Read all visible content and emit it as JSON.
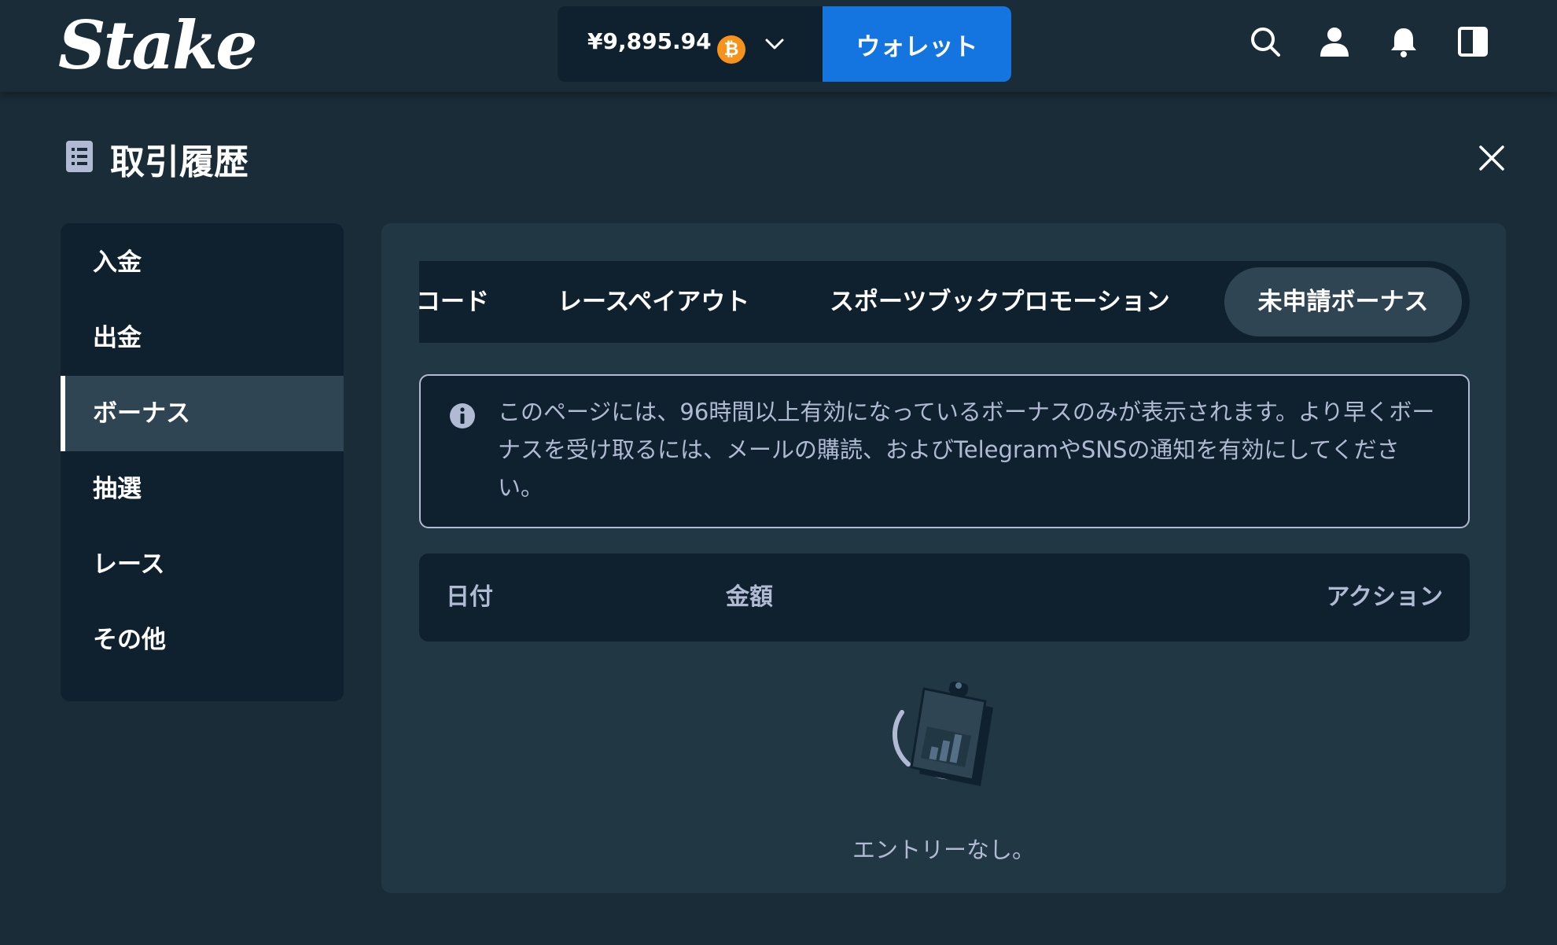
{
  "header": {
    "logo": "Stake",
    "balance": "¥9,895.94",
    "currency_icon": "bitcoin-icon",
    "wallet_label": "ウォレット",
    "icons": [
      "search-icon",
      "user-icon",
      "bell-icon",
      "sidebar-toggle-icon"
    ]
  },
  "page": {
    "title": "取引履歴",
    "title_icon": "list-icon",
    "close_icon": "close-icon"
  },
  "sidebar": {
    "items": [
      {
        "label": "入金",
        "active": false
      },
      {
        "label": "出金",
        "active": false
      },
      {
        "label": "ボーナス",
        "active": true
      },
      {
        "label": "抽選",
        "active": false
      },
      {
        "label": "レース",
        "active": false
      },
      {
        "label": "その他",
        "active": false
      }
    ]
  },
  "tabs": [
    {
      "label": "コード",
      "active": false
    },
    {
      "label": "レースペイアウト",
      "active": false
    },
    {
      "label": "スポーツブックプロモーション",
      "active": false
    },
    {
      "label": "未申請ボーナス",
      "active": true
    }
  ],
  "notice": {
    "icon": "info-icon",
    "text": "このページには、96時間以上有効になっているボーナスのみが表示されます。より早くボーナスを受け取るには、メールの購読、およびTelegramやSNSの通知を有効にしてください。"
  },
  "table": {
    "columns": [
      "日付",
      "金額",
      "アクション"
    ],
    "rows": []
  },
  "empty_state": {
    "illustration": "clipboard-chart-icon",
    "text": "エントリーなし。"
  },
  "colors": {
    "background": "#1a2c38",
    "panel": "#213743",
    "dark": "#0f212e",
    "active": "#2f4553",
    "accent": "#1475e1",
    "muted_text": "#b1bad3",
    "bitcoin": "#f7931a"
  }
}
